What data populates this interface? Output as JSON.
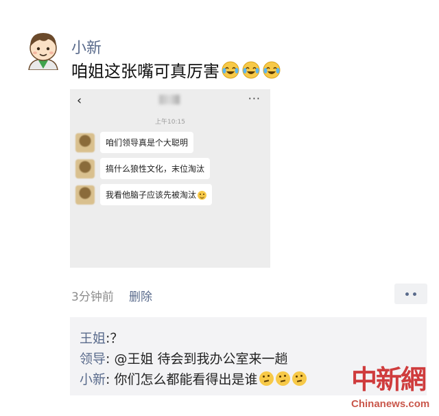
{
  "post": {
    "author": "小新",
    "text": "咱姐这张嘴可真厉害",
    "emoji_icon": "laugh-cry-emoji",
    "emoji_count": 3
  },
  "screenshot": {
    "back": "‹",
    "more": "···",
    "time": "上午10:15",
    "messages": [
      {
        "text": "咱们领导真是个大聪明"
      },
      {
        "text": "搞什么狼性文化，末位淘汰"
      },
      {
        "text": "我看他脑子应该先被淘汰"
      }
    ],
    "last_emoji": "smile-emoji"
  },
  "meta": {
    "time": "3分钟前",
    "delete": "删除"
  },
  "comments": [
    {
      "name": "王姐",
      "text": ":？"
    },
    {
      "name": "领导",
      "text": ": @王姐  待会到我办公室来一趟"
    },
    {
      "name": "小新",
      "text": ": 你们怎么都能看得出是谁"
    }
  ],
  "comment_emoji": "thinking-emoji",
  "watermark": {
    "cn": "中新網",
    "en": "Chinanews.com"
  },
  "colors": {
    "name_link": "#5a6b8c",
    "comment_bg": "#f3f3f5",
    "chat_bg": "#ededed",
    "watermark": "#c91d1d"
  }
}
